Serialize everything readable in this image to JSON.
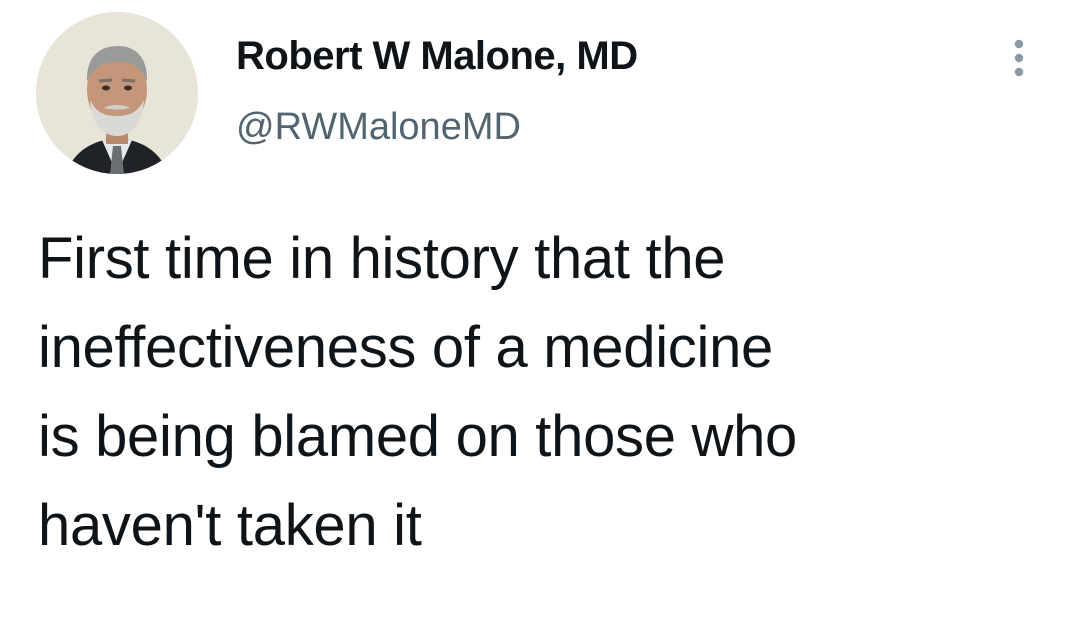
{
  "author": {
    "display_name": "Robert W Malone, MD",
    "handle": "@RWMaloneMD",
    "avatar_icon": "profile-photo"
  },
  "menu": {
    "icon": "more-vertical-icon"
  },
  "tweet": {
    "lines": [
      "First time in history that the",
      "ineffectiveness of a medicine",
      "is being blamed on those who",
      "haven't taken it"
    ]
  },
  "colors": {
    "text_primary": "#0f1419",
    "text_secondary": "#536471",
    "background": "#ffffff"
  }
}
